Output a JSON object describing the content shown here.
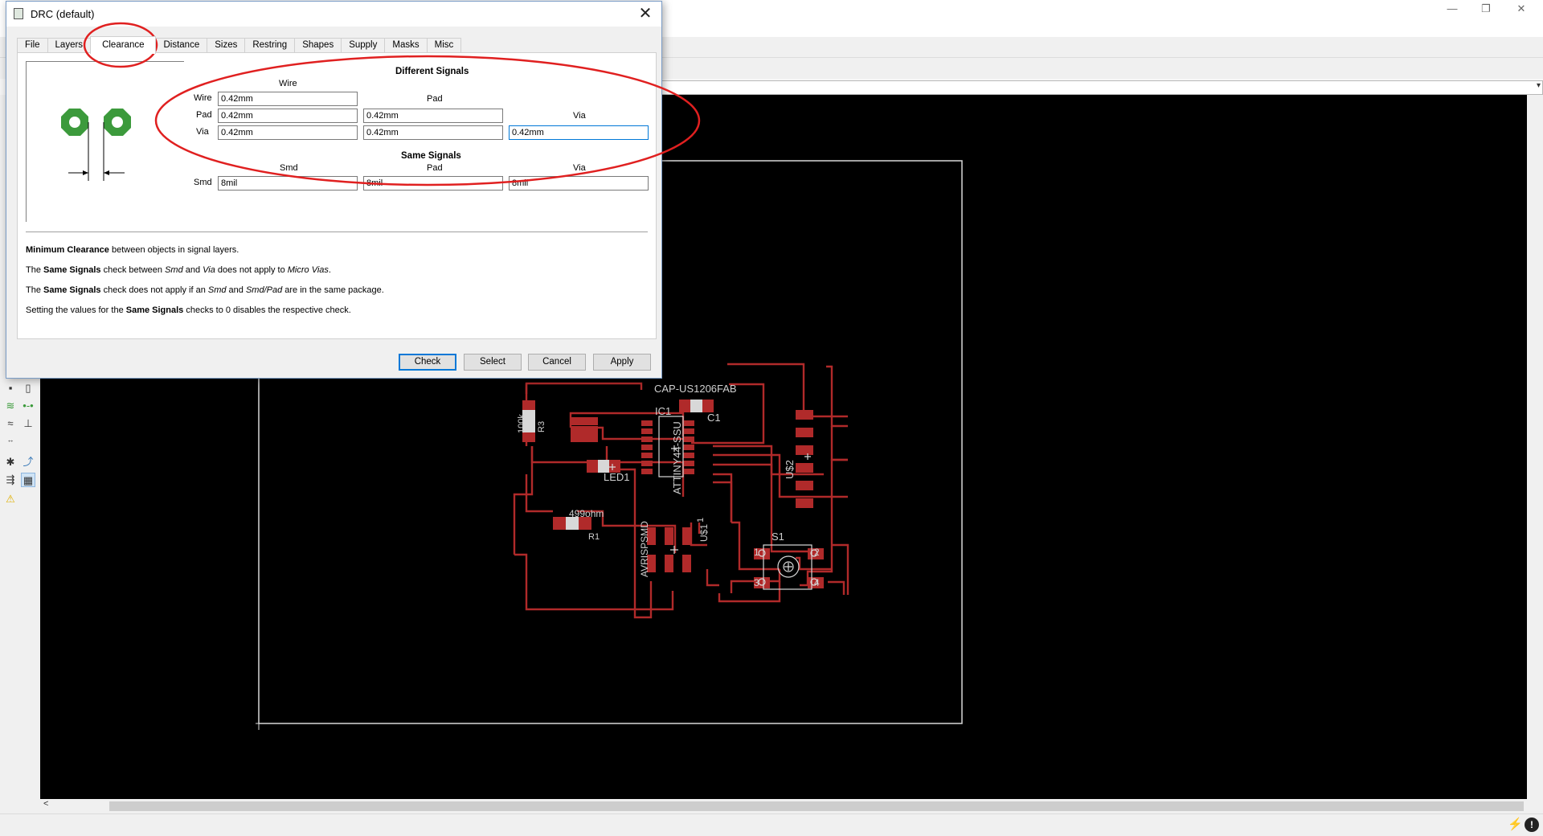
{
  "dialog": {
    "title": "DRC (default)",
    "close_glyph": "✕",
    "tabs": [
      {
        "label": "File"
      },
      {
        "label": "Layers"
      },
      {
        "label": "Clearance"
      },
      {
        "label": "Distance"
      },
      {
        "label": "Sizes"
      },
      {
        "label": "Restring"
      },
      {
        "label": "Shapes"
      },
      {
        "label": "Supply"
      },
      {
        "label": "Masks"
      },
      {
        "label": "Misc"
      }
    ],
    "active_tab": "Clearance",
    "different_signals": {
      "heading": "Different Signals",
      "col_wire": "Wire",
      "col_pad": "Pad",
      "col_via": "Via",
      "row_wire": "Wire",
      "row_pad": "Pad",
      "row_via": "Via",
      "wire_wire": "0.42mm",
      "pad_wire": "0.42mm",
      "pad_pad": "0.42mm",
      "via_wire": "0.42mm",
      "via_pad": "0.42mm",
      "via_via": "0.42mm"
    },
    "same_signals": {
      "heading": "Same Signals",
      "col_smd": "Smd",
      "col_pad": "Pad",
      "col_via": "Via",
      "row_smd": "Smd",
      "smd_smd": "8mil",
      "smd_pad": "8mil",
      "smd_via": "8mil"
    },
    "descriptions": {
      "line1_bold": "Minimum Clearance",
      "line1_rest": " between objects in signal layers.",
      "line2_a": "The ",
      "line2_bold": "Same Signals",
      "line2_b": " check between ",
      "line2_i1": "Smd",
      "line2_c": " and ",
      "line2_i2": "Via",
      "line2_d": " does not apply to ",
      "line2_i3": "Micro Vias",
      "line2_e": ".",
      "line3_a": "The ",
      "line3_bold": "Same Signals",
      "line3_b": " check does not apply if an ",
      "line3_i1": "Smd",
      "line3_c": " and ",
      "line3_i2": "Smd/Pad",
      "line3_d": " are in the same package.",
      "line4_a": "Setting the values for the ",
      "line4_bold": "Same Signals",
      "line4_b": " checks to 0 disables the respective check."
    },
    "buttons": {
      "check": "Check",
      "select": "Select",
      "cancel": "Cancel",
      "apply": "Apply"
    }
  },
  "board": {
    "labels": {
      "cap": "CAP-US1206FAB",
      "c1": "C1",
      "ic1": "IC1",
      "attiny": "ATTINY44-SSU",
      "r3": "R3",
      "r3_val": "100k",
      "led1": "LED1",
      "r1": "R1",
      "r1_val": "499ohm",
      "us2": "U$2",
      "us1": "U$1",
      "s1": "S1",
      "avrisp": "AVRISPSMD",
      "pin1": "1",
      "pin2": "2",
      "pin3": "3",
      "pin4": "4",
      "pin_u1": "1"
    },
    "colors": {
      "background": "#000000",
      "trace": "#b02a2a",
      "pad": "#b02a2a",
      "outline": "#d8d8d8",
      "label": "#cfcfcf"
    }
  },
  "window": {
    "minimize_glyph": "—",
    "restore_glyph": "❐",
    "close_glyph": "✕",
    "scroll_left_glyph": "<",
    "cmd_dropdown_glyph": "▾"
  },
  "annotation": {
    "color": "#e02020"
  }
}
